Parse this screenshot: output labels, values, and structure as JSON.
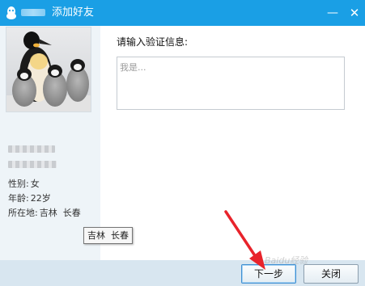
{
  "window": {
    "title": "添加好友",
    "minimize_label": "—",
    "close_label": "✕"
  },
  "profile": {
    "gender": {
      "label": "性别:",
      "value": "女"
    },
    "age": {
      "label": "年龄:",
      "value": "22岁"
    },
    "location": {
      "label": "所在地:",
      "value": "吉林  长春"
    }
  },
  "tooltip": {
    "text": "吉林  长春"
  },
  "verify": {
    "prompt": "请输入验证信息:",
    "placeholder": "我是..."
  },
  "buttons": {
    "next": "下一步",
    "close": "关闭"
  },
  "watermark": "Baidu经验",
  "colors": {
    "titlebar": "#1a9fe5",
    "sidebar": "#eef4f8",
    "footer": "#d8e6f0",
    "arrow": "#e8232b"
  },
  "icons": [
    "qq-penguin-icon",
    "minimize-icon",
    "close-icon"
  ]
}
